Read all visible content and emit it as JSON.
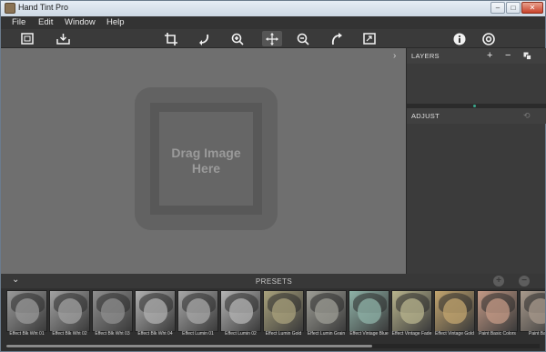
{
  "window": {
    "title": "Hand Tint Pro"
  },
  "menu": [
    "File",
    "Edit",
    "Window",
    "Help"
  ],
  "canvas": {
    "drop_text_line1": "Drag Image",
    "drop_text_line2": "Here"
  },
  "layers": {
    "title": "LAYERS"
  },
  "adjust": {
    "title": "ADJUST"
  },
  "presets": {
    "title": "PRESETS",
    "items": [
      {
        "label": "Effect Blk Wht 01",
        "tone": "#9a9a9a"
      },
      {
        "label": "Effect Blk Wht 02",
        "tone": "#a2a2a2"
      },
      {
        "label": "Effect Blk Wht 03",
        "tone": "#8f8f8f"
      },
      {
        "label": "Effect Blk Wht 04",
        "tone": "#b0b0b0"
      },
      {
        "label": "Effect Lumin 01",
        "tone": "#a8a8a8"
      },
      {
        "label": "Effect Lumin 02",
        "tone": "#b4b4b4"
      },
      {
        "label": "Effect Lumin Gold",
        "tone": "#a9a27c"
      },
      {
        "label": "Effect Lumin Grain",
        "tone": "#9e9e96"
      },
      {
        "label": "Effect Vintage Blue",
        "tone": "#8fb3a8"
      },
      {
        "label": "Effect Vintage Fade",
        "tone": "#b8b48d"
      },
      {
        "label": "Effect Vintage Gold",
        "tone": "#c3a56f"
      },
      {
        "label": "Paint Basic Colors",
        "tone": "#c49a86"
      },
      {
        "label": "Paint Basic",
        "tone": "#a89a8c"
      }
    ]
  },
  "colors": {
    "accent": "#3aa88c",
    "canvas_bg": "#6f6f6f",
    "panel_bg": "#3b3b3b"
  }
}
